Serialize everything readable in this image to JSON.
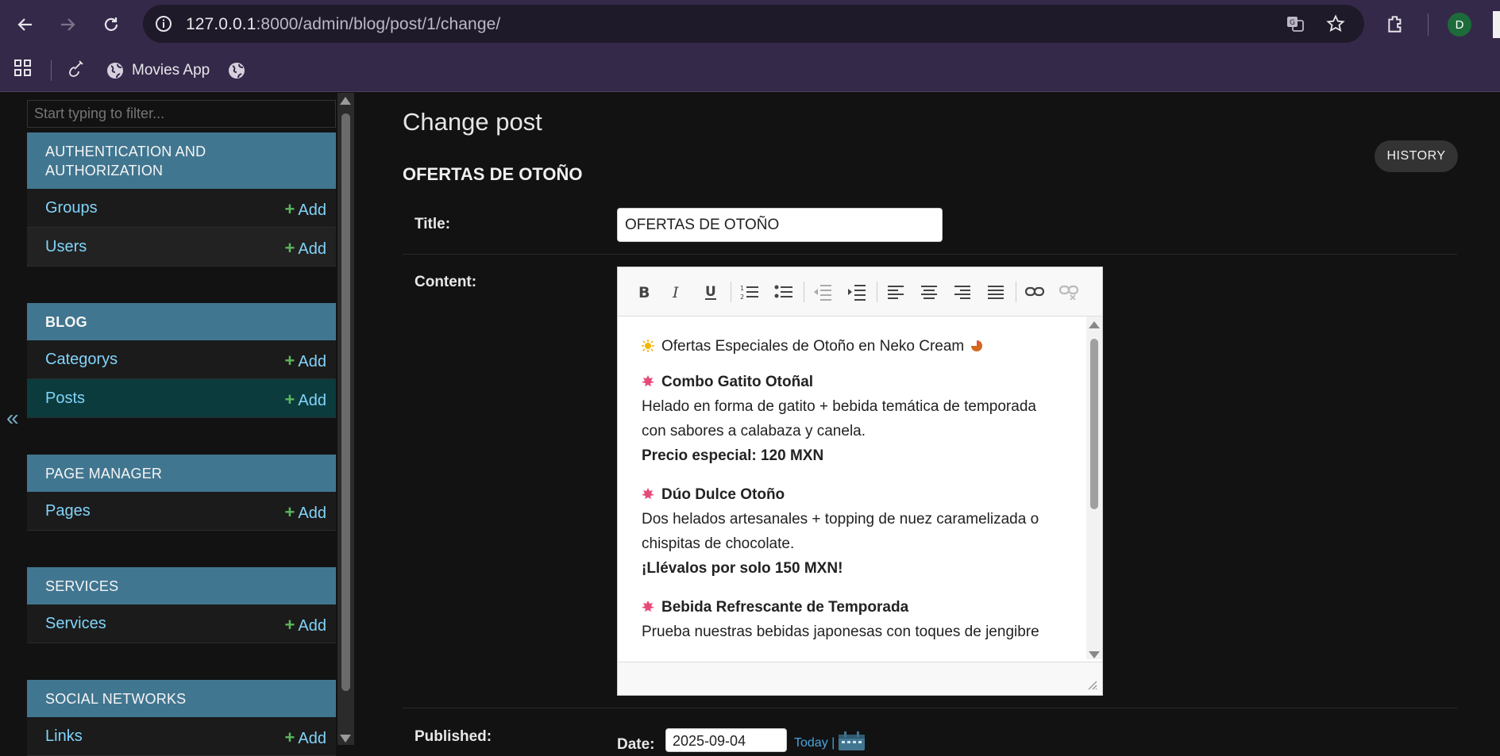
{
  "browser": {
    "url_host": "127.0.0.1",
    "url_rest": ":8000/admin/blog/post/1/change/",
    "profile_initial": "D",
    "bookmarks": [
      {
        "label": "Movies App"
      }
    ]
  },
  "sidebar": {
    "filter_placeholder": "Start typing to filter...",
    "collapse_glyph": "«",
    "modules": [
      {
        "header": "AUTHENTICATION AND AUTHORIZATION",
        "models": [
          {
            "label": "Groups",
            "add": "Add"
          },
          {
            "label": "Users",
            "add": "Add"
          }
        ]
      },
      {
        "header": "BLOG",
        "models": [
          {
            "label": "Categorys",
            "add": "Add"
          },
          {
            "label": "Posts",
            "add": "Add",
            "active": true
          }
        ]
      },
      {
        "header": "PAGE MANAGER",
        "models": [
          {
            "label": "Pages",
            "add": "Add"
          }
        ]
      },
      {
        "header": "SERVICES",
        "models": [
          {
            "label": "Services",
            "add": "Add"
          }
        ]
      },
      {
        "header": "SOCIAL NETWORKS",
        "models": [
          {
            "label": "Links",
            "add": "Add"
          }
        ]
      }
    ]
  },
  "content": {
    "page_title": "Change post",
    "history_button": "HISTORY",
    "object_name": "OFERTAS DE OTOÑO",
    "fields": {
      "title_label": "Title:",
      "title_value": "OFERTAS DE OTOÑO",
      "content_label": "Content:",
      "published_label": "Published:",
      "date_label": "Date:",
      "date_value": "2025-09-04",
      "today_link": "Today |"
    },
    "editor": {
      "toolbar": [
        "bold",
        "italic",
        "underline",
        "ordered-list",
        "unordered-list",
        "outdent",
        "indent",
        "align-left",
        "align-center",
        "align-right",
        "align-justify",
        "link",
        "unlink"
      ],
      "intro": "Ofertas Especiales de Otoño en Neko Cream",
      "items": [
        {
          "heading": "Combo Gatito Otoñal",
          "text": "Helado en forma de gatito + bebida temática de temporada con sabores a calabaza y canela.",
          "price": "Precio especial: 120 MXN"
        },
        {
          "heading": "Dúo Dulce Otoño",
          "text": "Dos helados artesanales + topping de nuez caramelizada o chispitas de chocolate.",
          "price": "¡Llévalos por solo 150 MXN!"
        },
        {
          "heading": "Bebida Refrescante de Temporada",
          "text": "Prueba nuestras bebidas japonesas con toques de jengibre",
          "price": ""
        }
      ]
    }
  },
  "colors": {
    "browser_chrome": "#35294a",
    "module_header": "#417690",
    "link": "#81d4fa",
    "add_plus": "#5bb75b",
    "active_row": "#0b3b3d"
  }
}
